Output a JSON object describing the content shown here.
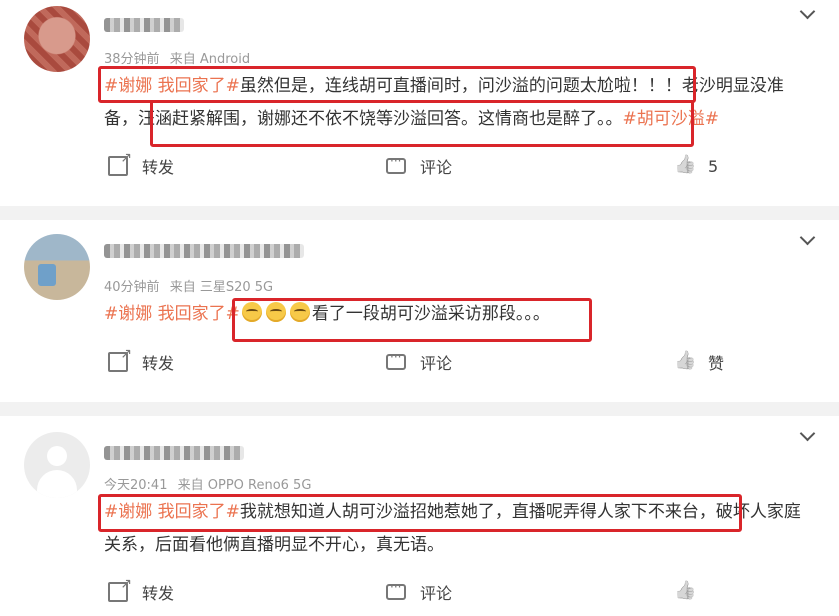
{
  "posts": [
    {
      "meta_time": "38分钟前",
      "meta_source": "来自 Android",
      "tag": "#谢娜 我回家了#",
      "text_before_emoji": "",
      "text": "虽然但是，连线胡可直播间时，问沙溢的问题太尬啦！！！老沙明显没准备，汪涵赶紧解围，谢娜还不依不饶等沙溢回答。这情商也是醉了。。",
      "tag2": "#胡可沙溢#",
      "share_label": "转发",
      "comment_label": "评论",
      "like_label": "5"
    },
    {
      "meta_time": "40分钟前",
      "meta_source": "来自 三星S20 5G",
      "tag": "#谢娜 我回家了#",
      "text": "看了一段胡可沙溢采访那段。。。",
      "share_label": "转发",
      "comment_label": "评论",
      "like_label": "赞"
    },
    {
      "meta_time": "今天20:41",
      "meta_source": "来自 OPPO Reno6 5G",
      "tag": "#谢娜 我回家了#",
      "text": "我就想知道人胡可沙溢招她惹她了，直播呢弄得人家下不来台，破坏人家庭关系，后面看他俩直播明显不开心，真无语。",
      "share_label": "转发",
      "comment_label": "评论",
      "like_label": ""
    }
  ],
  "colors": {
    "tag": "#eb7350",
    "highlight": "#d9252a",
    "separator": "#f2f2f2"
  },
  "icons": [
    "chevron-down-icon",
    "share-icon",
    "comment-icon",
    "like-icon",
    "crying-emoji-icon"
  ]
}
